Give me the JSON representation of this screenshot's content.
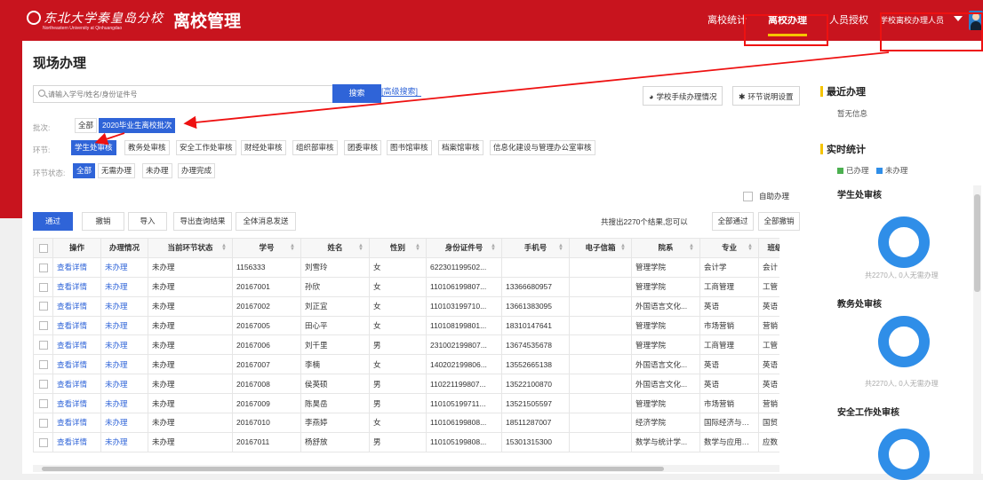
{
  "header": {
    "logo_cn": "东北大学秦皇岛分校",
    "logo_en": "Northeastern University at Qinhuangdao",
    "app_title": "离校管理",
    "nav": [
      "离校统计",
      "离校办理",
      "人员授权"
    ],
    "active_nav": "离校办理",
    "user_role": "学校离校办理人员",
    "accent_color": "#c8141e",
    "active_underline_color": "#f5c400"
  },
  "page": {
    "title": "现场办理",
    "search_placeholder": "请输入学号/姓名/身份证件号",
    "search_button": "搜索",
    "advanced_search": "[高级搜索]",
    "btn_school_handbook": "学校手续办理情况",
    "btn_step_settings": "环节说明设置",
    "filters": {
      "batch_label": "批次:",
      "batch_options": [
        "全部",
        "2020毕业生离校批次"
      ],
      "batch_selected": "2020毕业生离校批次",
      "step_label": "环节:",
      "step_options": [
        "学生处审核",
        "教务处审核",
        "安全工作处审核",
        "财经处审核",
        "组织部审核",
        "团委审核",
        "图书馆审核",
        "档案馆审核",
        "信息化建设与管理办公室审核"
      ],
      "step_selected": "学生处审核",
      "status_label": "环节状态:",
      "status_options": [
        "全部",
        "无需办理",
        "未办理",
        "办理完成"
      ],
      "status_selected": "全部"
    },
    "auto_handle_label": "自助办理",
    "actions": {
      "pass": "通过",
      "revoke": "撤销",
      "import": "导入",
      "export": "导出查询结果",
      "broadcast": "全体消息发送",
      "pass_all": "全部通过",
      "revoke_all": "全部撤销"
    },
    "result_count": "共搜出2270个结果,您可以"
  },
  "table": {
    "columns": [
      "操作",
      "办理情况",
      "当前环节状态",
      "学号",
      "姓名",
      "性别",
      "身份证件号",
      "手机号",
      "电子信箱",
      "院系",
      "专业",
      "班级"
    ],
    "rows": [
      [
        "查看详情",
        "未办理",
        "未办理",
        "1156333",
        "刘雪玲",
        "女",
        "622301199502...",
        "",
        "",
        "管理学院",
        "会计学",
        "会计"
      ],
      [
        "查看详情",
        "未办理",
        "未办理",
        "20167001",
        "孙欣",
        "女",
        "110106199807...",
        "13366680957",
        "",
        "管理学院",
        "工商管理",
        "工管"
      ],
      [
        "查看详情",
        "未办理",
        "未办理",
        "20167002",
        "刘正宜",
        "女",
        "110103199710...",
        "13661383095",
        "",
        "外国语言文化...",
        "英语",
        "英语"
      ],
      [
        "查看详情",
        "未办理",
        "未办理",
        "20167005",
        "田心平",
        "女",
        "110108199801...",
        "18310147641",
        "",
        "管理学院",
        "市场营销",
        "营销"
      ],
      [
        "查看详情",
        "未办理",
        "未办理",
        "20167006",
        "刘千里",
        "男",
        "231002199807...",
        "13674535678",
        "",
        "管理学院",
        "工商管理",
        "工管"
      ],
      [
        "查看详情",
        "未办理",
        "未办理",
        "20167007",
        "李楠",
        "女",
        "140202199806...",
        "13552665138",
        "",
        "外国语言文化...",
        "英语",
        "英语"
      ],
      [
        "查看详情",
        "未办理",
        "未办理",
        "20167008",
        "侯英硕",
        "男",
        "110221199807...",
        "13522100870",
        "",
        "外国语言文化...",
        "英语",
        "英语"
      ],
      [
        "查看详情",
        "未办理",
        "未办理",
        "20167009",
        "陈昊岳",
        "男",
        "110105199711...",
        "13521505597",
        "",
        "管理学院",
        "市场营销",
        "营销"
      ],
      [
        "查看详情",
        "未办理",
        "未办理",
        "20167010",
        "李燕婷",
        "女",
        "110106199808...",
        "18511287007",
        "",
        "经济学院",
        "国际经济与贸...",
        "国贸"
      ],
      [
        "查看详情",
        "未办理",
        "未办理",
        "20167011",
        "杨舒放",
        "男",
        "110105199808...",
        "15301315300",
        "",
        "数学与统计学...",
        "数学与应用数...",
        "应数"
      ]
    ]
  },
  "sidebar": {
    "recent_title": "最近办理",
    "recent_empty": "暂无信息",
    "stats_title": "实时统计",
    "legend_done": "已办理",
    "legend_todo": "未办理",
    "done_color": "#4cb050",
    "todo_color": "#2f8ee8",
    "stats": [
      {
        "name": "学生处审核",
        "summary": "共2270人, 0人无需办理",
        "done": 0,
        "todo": 2270
      },
      {
        "name": "教务处审核",
        "summary": "共2270人, 0人无需办理",
        "done": 0,
        "todo": 2270
      },
      {
        "name": "安全工作处审核",
        "summary": "",
        "done": 0,
        "todo": 2270
      }
    ]
  }
}
